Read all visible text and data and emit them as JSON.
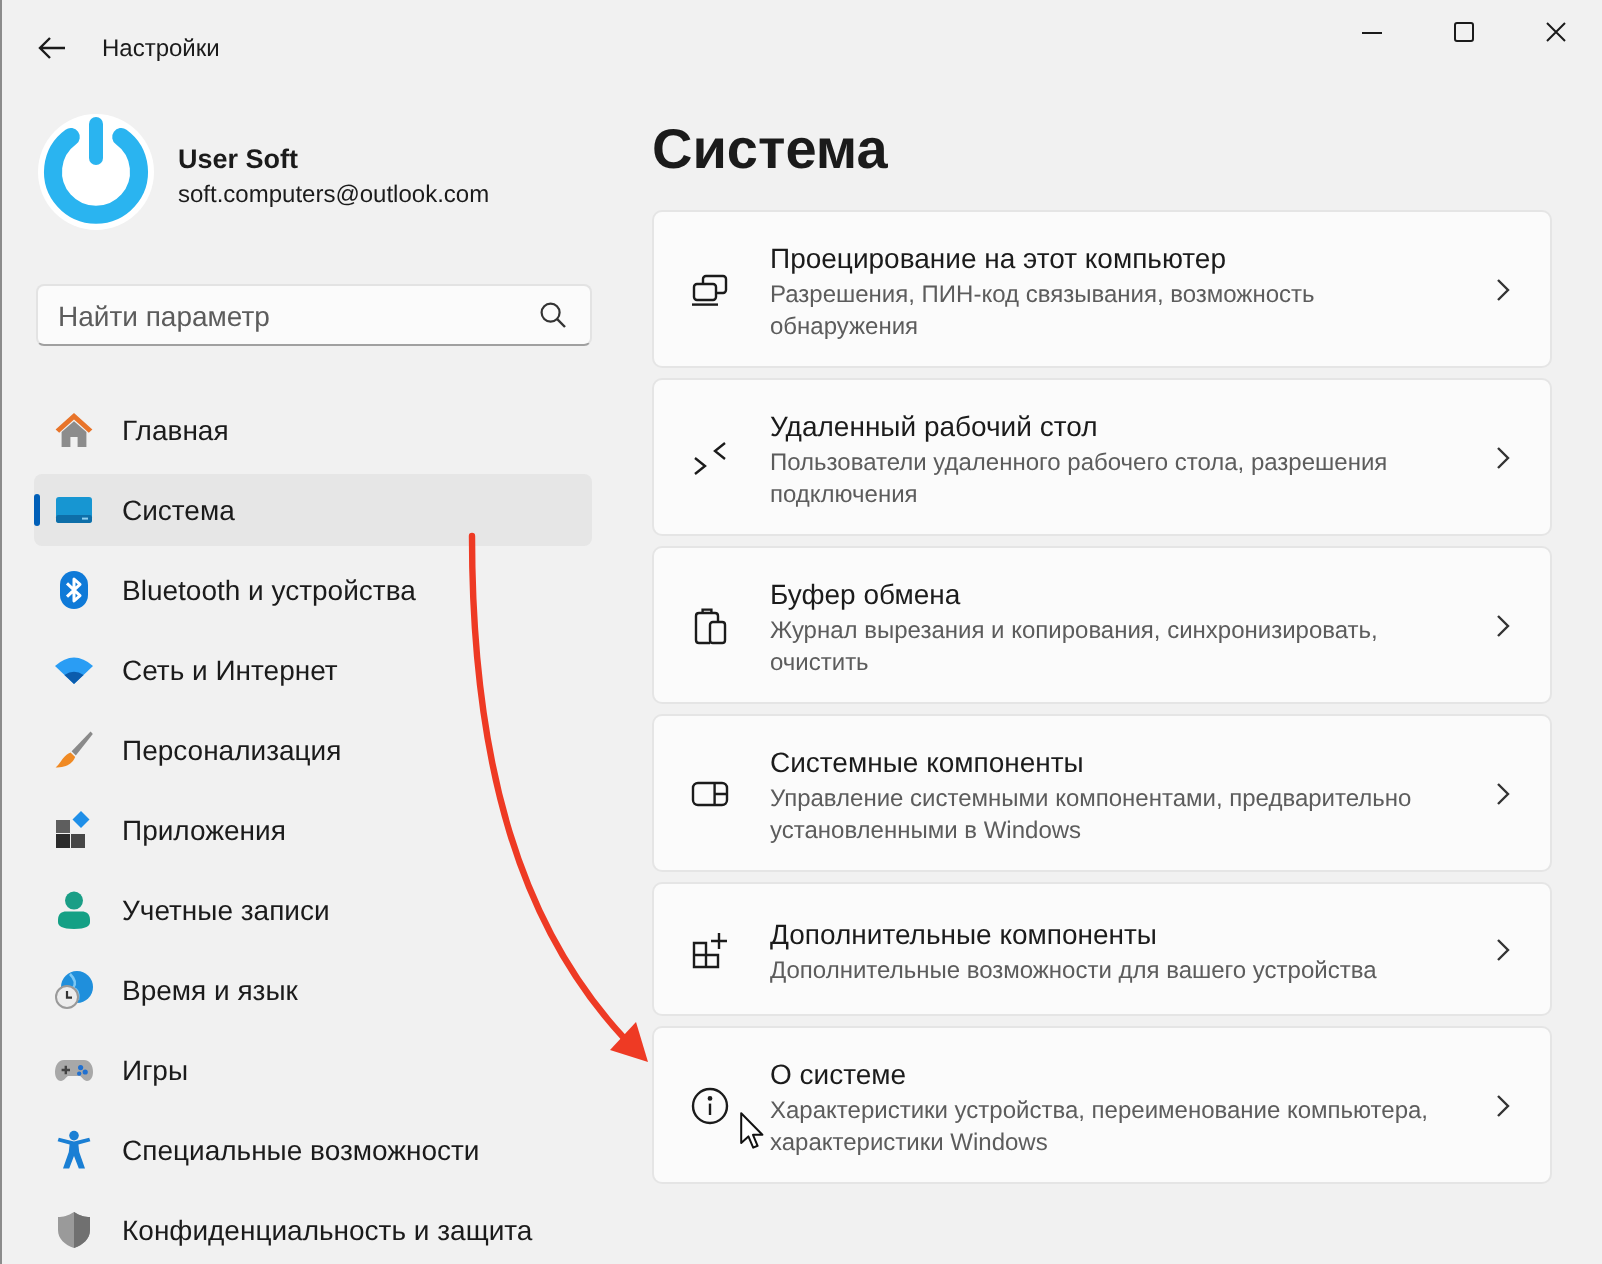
{
  "window": {
    "title": "Настройки"
  },
  "account": {
    "name": "User Soft",
    "email": "soft.computers@outlook.com"
  },
  "search": {
    "placeholder": "Найти параметр"
  },
  "nav": [
    {
      "label": "Главная",
      "selected": false
    },
    {
      "label": "Система",
      "selected": true
    },
    {
      "label": "Bluetooth и устройства",
      "selected": false
    },
    {
      "label": "Сеть и Интернет",
      "selected": false
    },
    {
      "label": "Персонализация",
      "selected": false
    },
    {
      "label": "Приложения",
      "selected": false
    },
    {
      "label": "Учетные записи",
      "selected": false
    },
    {
      "label": "Время и язык",
      "selected": false
    },
    {
      "label": "Игры",
      "selected": false
    },
    {
      "label": "Специальные возможности",
      "selected": false
    },
    {
      "label": "Конфиденциальность и защита",
      "selected": false
    }
  ],
  "page": {
    "title": "Система"
  },
  "cards": [
    {
      "title": "Проецирование на этот компьютер",
      "description": "Разрешения, ПИН-код связывания, возможность обнаружения"
    },
    {
      "title": "Удаленный рабочий стол",
      "description": "Пользователи удаленного рабочего стола, разрешения подключения"
    },
    {
      "title": "Буфер обмена",
      "description": "Журнал вырезания и копирования, синхронизировать, очистить"
    },
    {
      "title": "Системные компоненты",
      "description": "Управление системными компонентами, предварительно установленными в Windows"
    },
    {
      "title": "Дополнительные компоненты",
      "description": "Дополнительные возможности для вашего устройства"
    },
    {
      "title": "О системе",
      "description": "Характеристики устройства, переименование компьютера, характеристики Windows"
    }
  ]
}
